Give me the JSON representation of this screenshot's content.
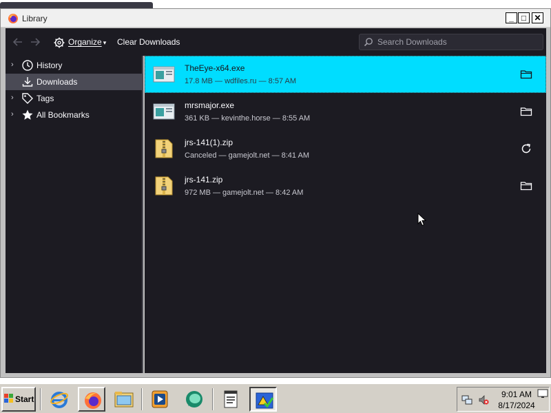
{
  "window": {
    "title": "Library",
    "controls": {
      "minimize": "_",
      "maximize": "□",
      "close": "✕"
    }
  },
  "toolbar": {
    "back_icon": "arrow-left-icon",
    "forward_icon": "arrow-right-icon",
    "organize_label": "Organize",
    "clear_downloads_label": "Clear Downloads",
    "search_placeholder": "Search Downloads"
  },
  "sidebar": {
    "items": [
      {
        "label": "History",
        "icon": "clock-icon",
        "expandable": true,
        "selected": false
      },
      {
        "label": "Downloads",
        "icon": "download-icon",
        "expandable": false,
        "selected": true
      },
      {
        "label": "Tags",
        "icon": "tag-icon",
        "expandable": true,
        "selected": false
      },
      {
        "label": "All Bookmarks",
        "icon": "star-icon",
        "expandable": true,
        "selected": false
      }
    ]
  },
  "downloads": [
    {
      "name": "TheEye-x64.exe",
      "meta": "17.8 MB — wdfiles.ru — 8:57 AM",
      "type": "exe",
      "action_icon": "folder-icon",
      "selected": true
    },
    {
      "name": "mrsmajor.exe",
      "meta": "361 KB — kevinthe.horse — 8:55 AM",
      "type": "exe",
      "action_icon": "folder-icon",
      "selected": false
    },
    {
      "name": "jrs-141(1).zip",
      "meta": "Canceled — gamejolt.net — 8:41 AM",
      "type": "zip",
      "action_icon": "retry-icon",
      "selected": false
    },
    {
      "name": "jrs-141.zip",
      "meta": "972 MB — gamejolt.net — 8:42 AM",
      "type": "zip",
      "action_icon": "folder-icon",
      "selected": false
    }
  ],
  "taskbar": {
    "start_label": "Start",
    "quick_launch": [
      "internet-explorer-icon",
      "firefox-icon",
      "file-explorer-icon",
      "media-player-icon",
      "messenger-icon",
      "notepad-icon",
      "program-icon"
    ],
    "clock_time": "9:01 AM",
    "clock_date": "8/17/2024"
  },
  "colors": {
    "selection": "#00ddff",
    "panel_bg": "#1c1b22",
    "taskbar": "#d4d0c8"
  }
}
